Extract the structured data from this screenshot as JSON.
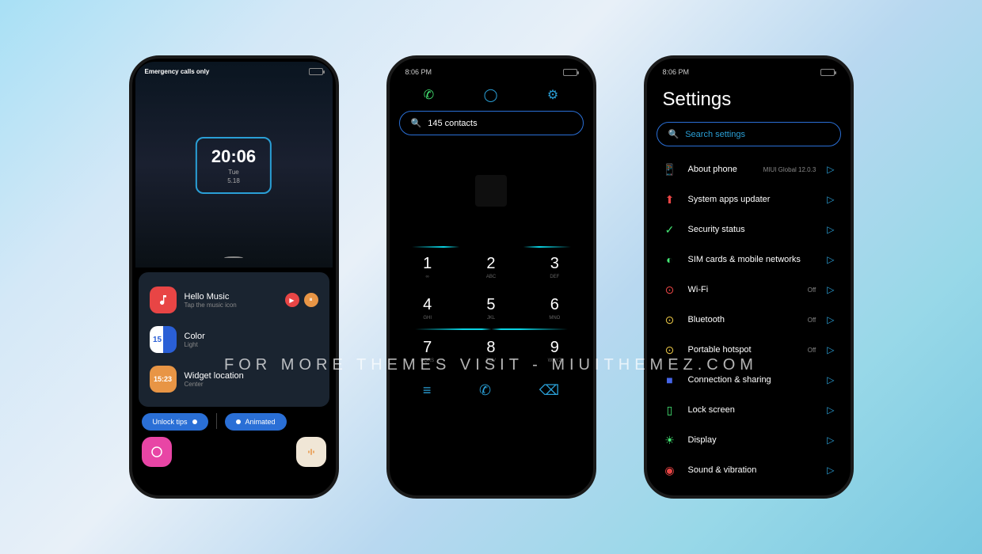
{
  "watermark": "FOR MORE THEMES VISIT - MIUITHEMEZ.COM",
  "phone1": {
    "status": {
      "left": "Emergency calls only"
    },
    "clock": {
      "time": "20:06",
      "day": "Tue",
      "date": "5.18"
    },
    "music": {
      "title": "Hello Music",
      "sub": "Tap the music icon"
    },
    "color": {
      "title": "Color",
      "sub": "Light",
      "iconText": "15 25"
    },
    "widget": {
      "title": "Widget location",
      "sub": "Center",
      "iconText": "15:23"
    },
    "chips": {
      "unlock": "Unlock tips",
      "animated": "Animated"
    }
  },
  "phone2": {
    "status": {
      "time": "8:06 PM"
    },
    "search": "145 contacts",
    "keys": [
      {
        "n": "1",
        "s": "∞"
      },
      {
        "n": "2",
        "s": "ABC"
      },
      {
        "n": "3",
        "s": "DEF"
      },
      {
        "n": "4",
        "s": "GHI"
      },
      {
        "n": "5",
        "s": "JKL"
      },
      {
        "n": "6",
        "s": "MNO"
      },
      {
        "n": "7",
        "s": "PQRS"
      },
      {
        "n": "8",
        "s": "TUV"
      },
      {
        "n": "9",
        "s": "WXYZ"
      }
    ]
  },
  "phone3": {
    "status": {
      "time": "8:06 PM"
    },
    "title": "Settings",
    "search": "Search settings",
    "items": [
      {
        "label": "About phone",
        "meta": "MIUI Global 12.0.3",
        "icon": "📱",
        "color": "#e8a545"
      },
      {
        "label": "System apps updater",
        "meta": "",
        "icon": "⬆",
        "color": "#e84545"
      },
      {
        "label": "Security status",
        "meta": "",
        "icon": "✓",
        "color": "#45e875"
      },
      {
        "label": "SIM cards & mobile networks",
        "meta": "",
        "icon": "◐",
        "color": "#45e875"
      },
      {
        "label": "Wi-Fi",
        "meta": "Off",
        "icon": "⊙",
        "color": "#e84545"
      },
      {
        "label": "Bluetooth",
        "meta": "Off",
        "icon": "⊙",
        "color": "#e8c545"
      },
      {
        "label": "Portable hotspot",
        "meta": "Off",
        "icon": "⊙",
        "color": "#e8c545"
      },
      {
        "label": "Connection & sharing",
        "meta": "",
        "icon": "■",
        "color": "#4565e8"
      },
      {
        "label": "Lock screen",
        "meta": "",
        "icon": "▯",
        "color": "#45e875"
      },
      {
        "label": "Display",
        "meta": "",
        "icon": "☀",
        "color": "#45e875"
      },
      {
        "label": "Sound & vibration",
        "meta": "",
        "icon": "◉",
        "color": "#e84545"
      }
    ]
  }
}
